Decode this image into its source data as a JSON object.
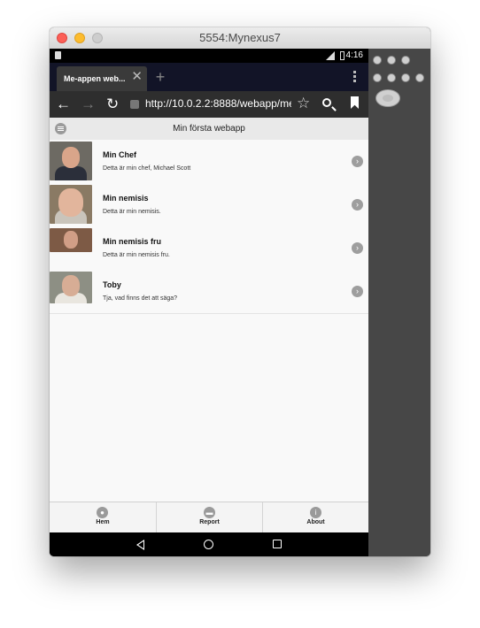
{
  "window": {
    "title": "5554:Mynexus7"
  },
  "statusbar": {
    "time": "4:16"
  },
  "browser": {
    "tab_title": "Me-appen web...",
    "tab_close": "✕",
    "new_tab": "+",
    "back": "←",
    "forward": "→",
    "reload": "↻",
    "star": "☆",
    "url": "http://10.0.2.2:8888/webapp/me/i"
  },
  "app": {
    "title": "Min första webapp",
    "items": [
      {
        "name": "Min Chef",
        "desc": "Detta är min chef, Michael Scott"
      },
      {
        "name": "Min nemisis",
        "desc": "Detta är min nemisis."
      },
      {
        "name": "Min nemisis fru",
        "desc": "Detta är min nemisis fru."
      },
      {
        "name": "Toby",
        "desc": "Tja, vad finns det att säga?"
      }
    ],
    "chevron": "›",
    "tabs": [
      {
        "label": "Hem",
        "icon": "person-icon"
      },
      {
        "label": "Report",
        "icon": "chat-icon"
      },
      {
        "label": "About",
        "icon": "info-icon"
      }
    ]
  },
  "colors": {
    "header_bg": "#e9e9e9",
    "content_bg": "#f9f9f9",
    "icon_gray": "#9a9a9a"
  }
}
